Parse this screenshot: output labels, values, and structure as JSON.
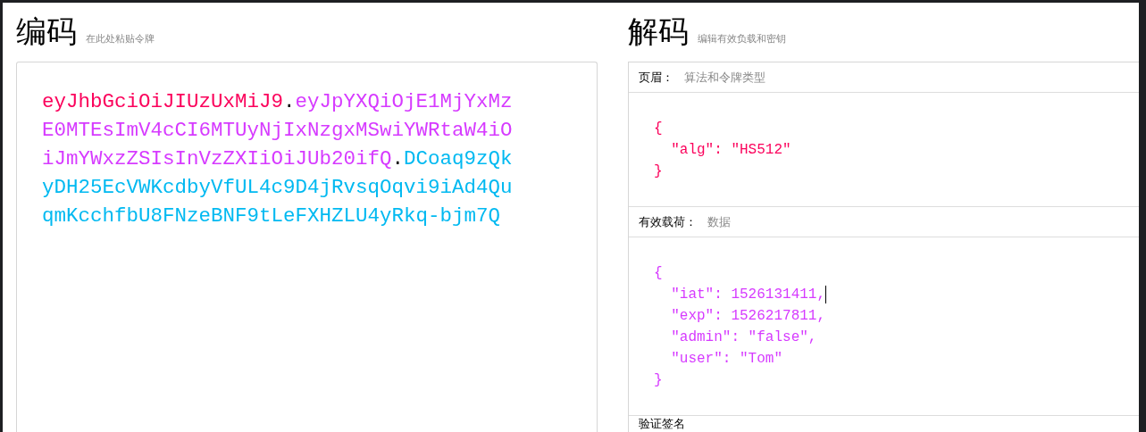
{
  "encoded": {
    "title": "编码",
    "subtitle": "在此处粘贴令牌",
    "token_parts": [
      {
        "text": "eyJhbGciOiJIUzUxMiJ9",
        "kind": "header"
      },
      {
        "text": ".",
        "kind": "dot"
      },
      {
        "text": "eyJpYXQiOjE1MjYxMzE0MTEsImV4cCI6MTUyNjIxNzgxMSwiYWRtaW4iOiJmYWxzZSIsInVzZXIiOiJUb20ifQ",
        "kind": "payload"
      },
      {
        "text": ".",
        "kind": "dot"
      },
      {
        "text": "DCoaq9zQkyDH25EcVWKcdbyVfUL4c9D4jRvsqOqvi9iAd4QuqmKcchfbU8FNzeBNF9tLeFXHZLU4yRkq-bjm7Q",
        "kind": "signature"
      }
    ]
  },
  "decoded": {
    "title": "解码",
    "subtitle": "编辑有效负载和密钥",
    "sections": [
      {
        "label": "页眉：",
        "hint": "算法和令牌类型",
        "kind": "header",
        "lines": [
          "{",
          "  \"alg\": \"HS512\"",
          "}"
        ]
      },
      {
        "label": "有效载荷：",
        "hint": "数据",
        "kind": "payload",
        "lines": [
          "{",
          "  \"iat\": 1526131411,",
          "  \"exp\": 1526217811,",
          "  \"admin\": \"false\",",
          "  \"user\": \"Tom\"",
          "}"
        ]
      },
      {
        "label": "验证签名"
      }
    ]
  }
}
